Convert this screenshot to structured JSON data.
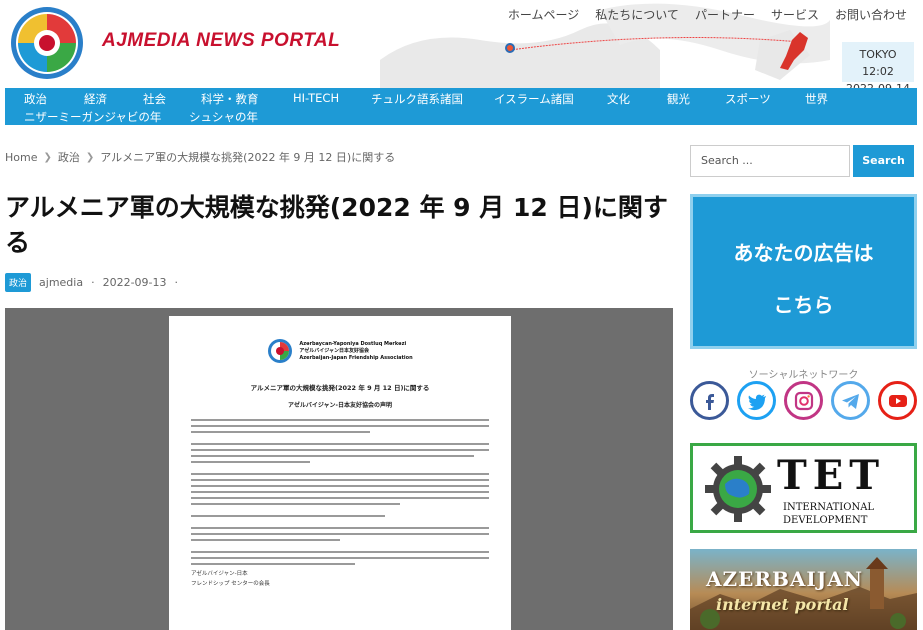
{
  "header": {
    "site_title": "AJMEDIA NEWS PORTAL",
    "top_nav": [
      "ホームページ",
      "私たちについて",
      "パートナー",
      "サービス",
      "お問い合わせ"
    ],
    "clock": {
      "city_time": "TOKYO 12:02",
      "date": "2022-09-14"
    }
  },
  "main_nav": {
    "items": [
      "政治",
      "経済",
      "社会",
      "科学・教育",
      "HI-TECH",
      "チュルク語系諸国",
      "イスラーム諸国",
      "文化",
      "観光",
      "スポーツ",
      "世界",
      "ニザーミーガンジャビの年",
      "シュシャの年"
    ]
  },
  "breadcrumb": {
    "home": "Home",
    "category": "政治",
    "current": "アルメニア軍の大規模な挑発(2022 年 9 月 12 日)に関する"
  },
  "article": {
    "title": "アルメニア軍の大規模な挑発(2022 年 9 月 12 日)に関する",
    "category": "政治",
    "author": "ajmedia",
    "date": "2022-09-13",
    "document": {
      "org_line1": "Azərbaycan-Yaponiya Dostluq Mərkəzi",
      "org_line2": "アゼルバイジャン日本友好協会",
      "org_line3": "Azerbaijan-Japan Friendship Association",
      "heading": "アルメニア軍の大規模な挑発(2022 年 9 月 12 日)に関する",
      "subheading": "アゼルバイジャン-日本友好協会の声明",
      "signature_line1": "アゼルバイジャン-日本",
      "signature_line2": "フレンドシップ センターの会長"
    }
  },
  "sidebar": {
    "search_placeholder": "Search ...",
    "search_button": "Search",
    "ad_line1": "あなたの広告は",
    "ad_line2": "こちら",
    "social_title": "ソーシャルネットワーク",
    "social_icons": [
      "facebook-icon",
      "twitter-icon",
      "instagram-icon",
      "telegram-icon",
      "youtube-icon"
    ],
    "tet": {
      "name": "TET",
      "line1": "INTERNATIONAL",
      "line2": "DEVELOPMENT"
    },
    "az_portal": {
      "title": "AZERBAIJAN",
      "subtitle": "internet portal"
    }
  },
  "colors": {
    "accent": "#1e9ad6",
    "brand_red": "#c8102e",
    "tet_green": "#3aa845"
  }
}
